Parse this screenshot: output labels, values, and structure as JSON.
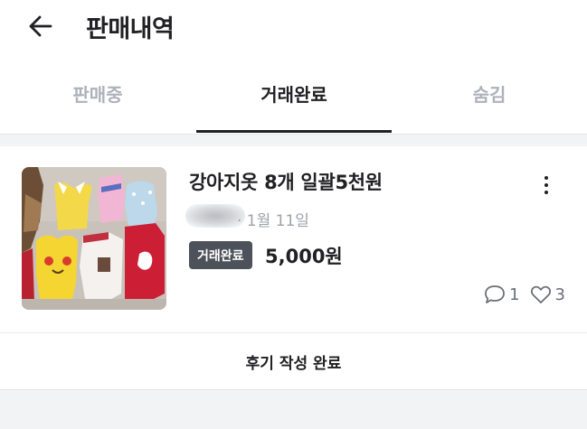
{
  "header": {
    "title": "판매내역"
  },
  "tabs": [
    {
      "label": "판매중",
      "active": false
    },
    {
      "label": "거래완료",
      "active": true
    },
    {
      "label": "숨김",
      "active": false
    }
  ],
  "item": {
    "title": "강아지옷 8개 일괄5천원",
    "date": "· 1월 11일",
    "status_badge": "거래완료",
    "price": "5,000원",
    "chat_count": "1",
    "like_count": "3"
  },
  "review": {
    "label": "후기 작성 완료"
  },
  "colors": {
    "badge_bg": "#4d5159",
    "active_tab": "#212124",
    "inactive_tab": "#adb1ba"
  }
}
